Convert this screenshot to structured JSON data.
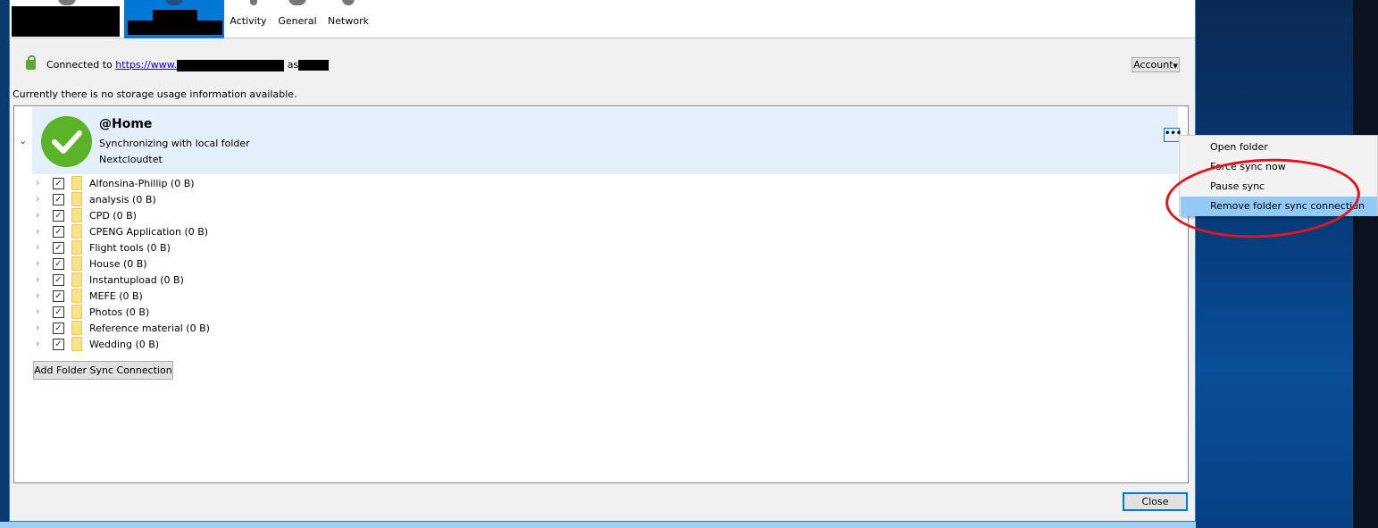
{
  "toolbar": {
    "tabs": [
      {
        "label": ""
      },
      {
        "label": ""
      },
      {
        "label": "Activity"
      },
      {
        "label": "General"
      },
      {
        "label": "Network"
      }
    ],
    "active_tab_color": "#0078d7"
  },
  "connection": {
    "prefix": "Connected to",
    "url": "https://www.",
    "as": "as",
    "account_button": "Account"
  },
  "storage_text": "Currently there is no storage usage information available.",
  "folder": {
    "title": "@Home",
    "status": "Synchronizing with local folder",
    "remote": "Nextcloudtet",
    "status_color": "#5db327",
    "more_button": "•••"
  },
  "subfolders": [
    {
      "name": "Alfonsina-Phillip (0 B)",
      "checked": true
    },
    {
      "name": "analysis (0 B)",
      "checked": true
    },
    {
      "name": "CPD (0 B)",
      "checked": true
    },
    {
      "name": "CPENG Application (0 B)",
      "checked": true
    },
    {
      "name": "Flight tools (0 B)",
      "checked": true
    },
    {
      "name": "House (0 B)",
      "checked": true
    },
    {
      "name": "Instantupload (0 B)",
      "checked": true
    },
    {
      "name": "MEFE (0 B)",
      "checked": true
    },
    {
      "name": "Photos (0 B)",
      "checked": true
    },
    {
      "name": "Reference material (0 B)",
      "checked": true
    },
    {
      "name": "Wedding (0 B)",
      "checked": true
    }
  ],
  "add_button": "Add Folder Sync Connection",
  "close_button": "Close",
  "context_menu": {
    "items": [
      {
        "label": "Open folder"
      },
      {
        "label": "Force sync now"
      },
      {
        "label": "Pause sync"
      },
      {
        "label": "Remove folder sync connection",
        "highlighted": true
      }
    ],
    "annotation_color": "#e0161e"
  }
}
